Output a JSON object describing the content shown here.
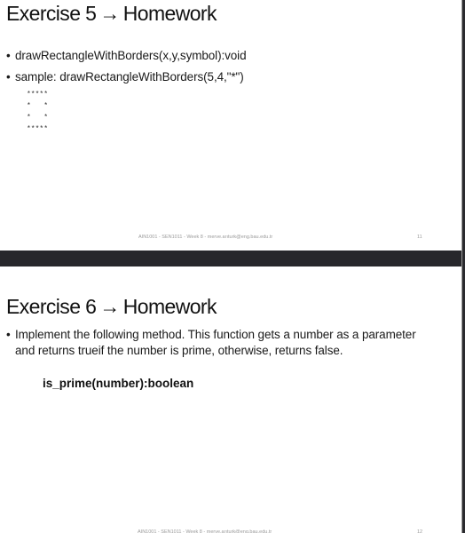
{
  "slides": [
    {
      "title": "Exercise 5",
      "arrow": "→",
      "title_suffix": "Homework",
      "bullets": [
        "drawRectangleWithBorders(x,y,symbol):void",
        "sample: drawRectangleWithBorders(5,4,\"*\")"
      ],
      "ascii_art": "*****\n*   *\n*   *\n*****",
      "footer": {
        "text": "AIN1001 - SEN1011 - Week 8 - merve.arıturk@eng.bau.edu.tr",
        "page": "11"
      }
    },
    {
      "title": "Exercise 6",
      "arrow": "→",
      "title_suffix": "Homework",
      "bullets": [
        "Implement the following method. This function gets a number as a parameter and returns trueif the number is prime, otherwise, returns false."
      ],
      "code": "is_prime(number):boolean",
      "footer": {
        "text": "AIN1001 - SEN1011 - Week 8 - merve.arıturk@eng.bau.edu.tr",
        "page": "12"
      }
    }
  ],
  "bullet_glyph": "•"
}
